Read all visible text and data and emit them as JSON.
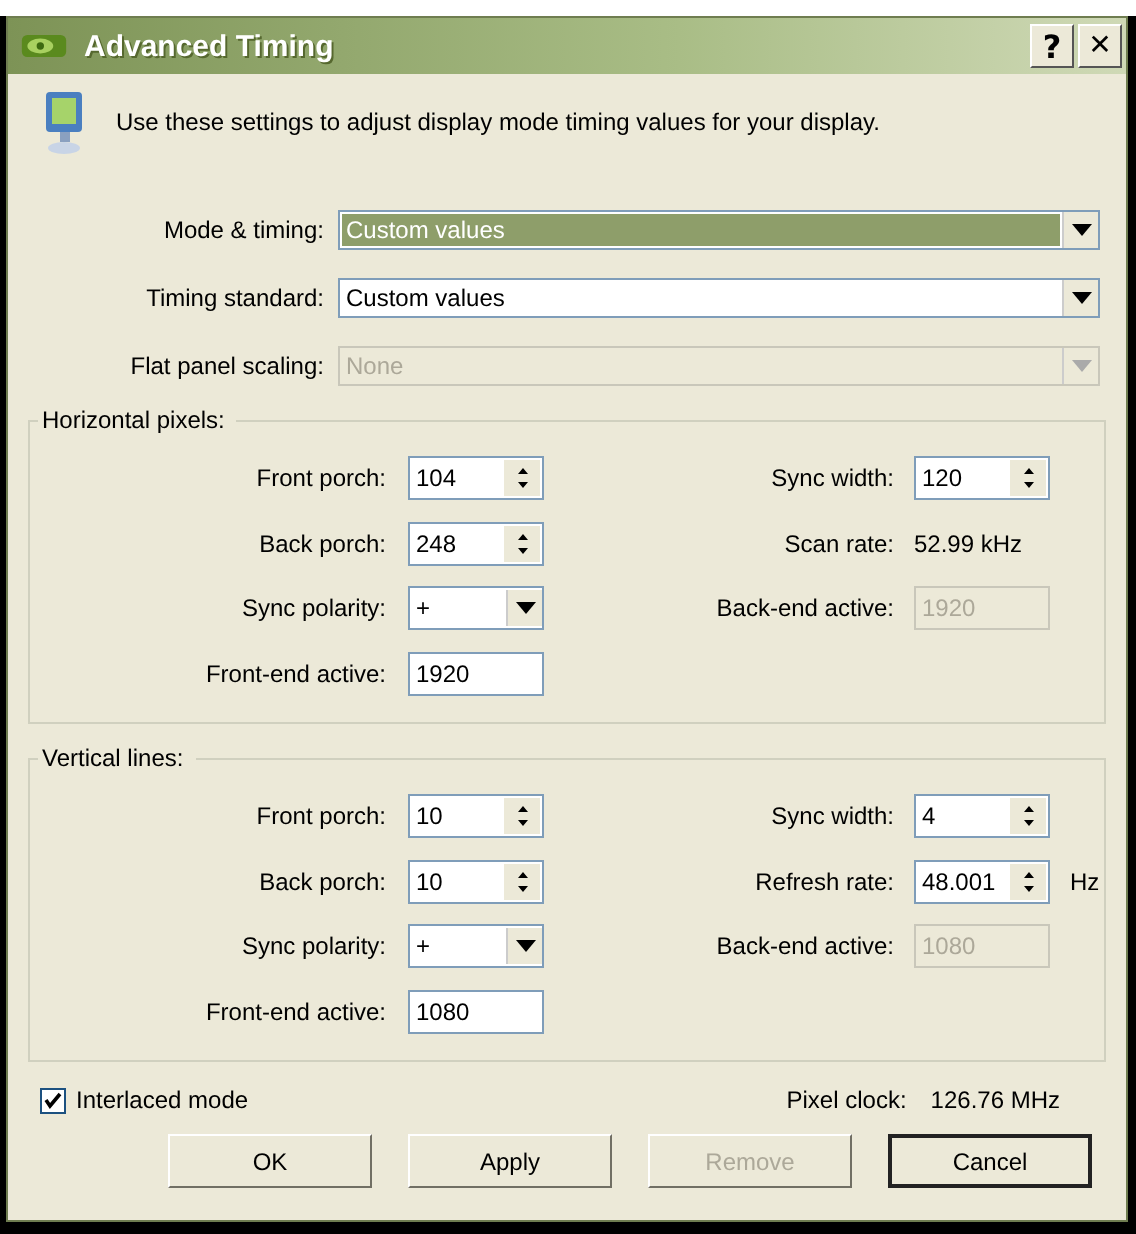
{
  "window": {
    "title": "Advanced Timing",
    "buttons": [
      {
        "kind": "help",
        "label": "?"
      },
      {
        "kind": "close",
        "label": "✕"
      }
    ]
  },
  "description": "Use these settings to adjust display mode timing values for your display.",
  "dropdowns": [
    {
      "label": "Mode & timing:",
      "value": "Custom values",
      "selected": true,
      "disabled": false
    },
    {
      "label": "Timing standard:",
      "value": "Custom values",
      "selected": false,
      "disabled": false
    },
    {
      "label": "Flat panel scaling:",
      "value": "None",
      "selected": false,
      "disabled": true
    }
  ],
  "groups": [
    {
      "title": "Horizontal pixels:",
      "rows": [
        {
          "left": {
            "kind": "spin",
            "label": "Front porch:",
            "value": "104"
          },
          "right": {
            "kind": "spin",
            "label": "Sync width:",
            "value": "120"
          }
        },
        {
          "left": {
            "kind": "spin",
            "label": "Back porch:",
            "value": "248"
          },
          "right": {
            "kind": "reading",
            "label": "Scan rate:",
            "value": "52.99 kHz"
          }
        },
        {
          "left": {
            "kind": "combo",
            "label": "Sync polarity:",
            "value": "+"
          },
          "right": {
            "kind": "disabled",
            "label": "Back-end active:",
            "value": "1920"
          }
        },
        {
          "left": {
            "kind": "field",
            "label": "Front-end active:",
            "value": "1920"
          }
        }
      ]
    },
    {
      "title": "Vertical lines:",
      "rows": [
        {
          "left": {
            "kind": "spin",
            "label": "Front porch:",
            "value": "10"
          },
          "right": {
            "kind": "spin",
            "label": "Sync width:",
            "value": "4"
          }
        },
        {
          "left": {
            "kind": "spin",
            "label": "Back porch:",
            "value": "10"
          },
          "right": {
            "kind": "spin",
            "label": "Refresh rate:",
            "value": "48.001",
            "unit": "Hz"
          }
        },
        {
          "left": {
            "kind": "combo",
            "label": "Sync polarity:",
            "value": "+"
          },
          "right": {
            "kind": "disabled",
            "label": "Back-end active:",
            "value": "1080"
          }
        },
        {
          "left": {
            "kind": "field",
            "label": "Front-end active:",
            "value": "1080"
          }
        }
      ]
    }
  ],
  "interlaced": {
    "label": "Interlaced mode",
    "checked": true
  },
  "pixel_clock": {
    "label": "Pixel clock:",
    "value": "126.76 MHz"
  },
  "buttons": [
    {
      "label": "OK",
      "disabled": false,
      "default": false
    },
    {
      "label": "Apply",
      "disabled": false,
      "default": false
    },
    {
      "label": "Remove",
      "disabled": true,
      "default": false
    },
    {
      "label": "Cancel",
      "disabled": false,
      "default": true
    }
  ]
}
